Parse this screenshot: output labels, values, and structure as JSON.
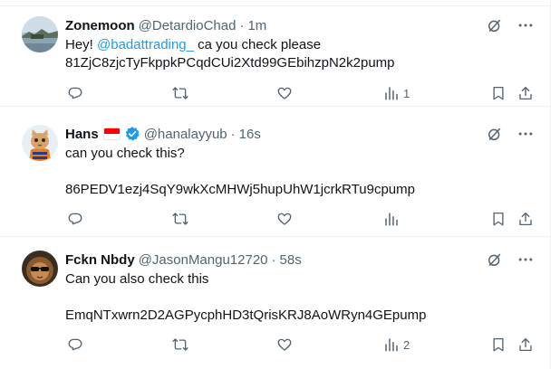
{
  "tweets": [
    {
      "display_name": "Zonemoon",
      "handle": "@DetardioChad",
      "separator": "·",
      "time": "1m",
      "text_prefix": "Hey! ",
      "mention": "@badattrading_",
      "text_suffix": " ca you check please",
      "line2": "81ZjC8zjcTyFkppkPCqdCUi2Xtd99GEbihzpN2k2pump",
      "views": "1",
      "avatar": "landscape-photo"
    },
    {
      "display_name": "Hans",
      "flag": "indonesia-flag",
      "verified": true,
      "handle": "@hanalayyub",
      "separator": "·",
      "time": "16s",
      "line1": "can you check this?",
      "line2": "86PEDV1ezj4SqY9wkXcMHWj5hupUhW1jcrkRTu9cpump",
      "views": "",
      "avatar": "cat-in-orange-outfit"
    },
    {
      "display_name": "Fckn Nbdy",
      "handle": "@JasonMangu12720",
      "separator": "·",
      "time": "58s",
      "line1": "Can you also check this",
      "line2": "EmqNTxwrn2D2AGPycphHD3tQrisKRJ8AoWRyn4GEpump",
      "views": "2",
      "avatar": "lion-with-sunglasses"
    }
  ],
  "colors": {
    "text": "#0f1419",
    "secondary": "#536471",
    "link": "#1d9bf0",
    "verified": "#1d9bf0",
    "border": "#eff3f4"
  }
}
